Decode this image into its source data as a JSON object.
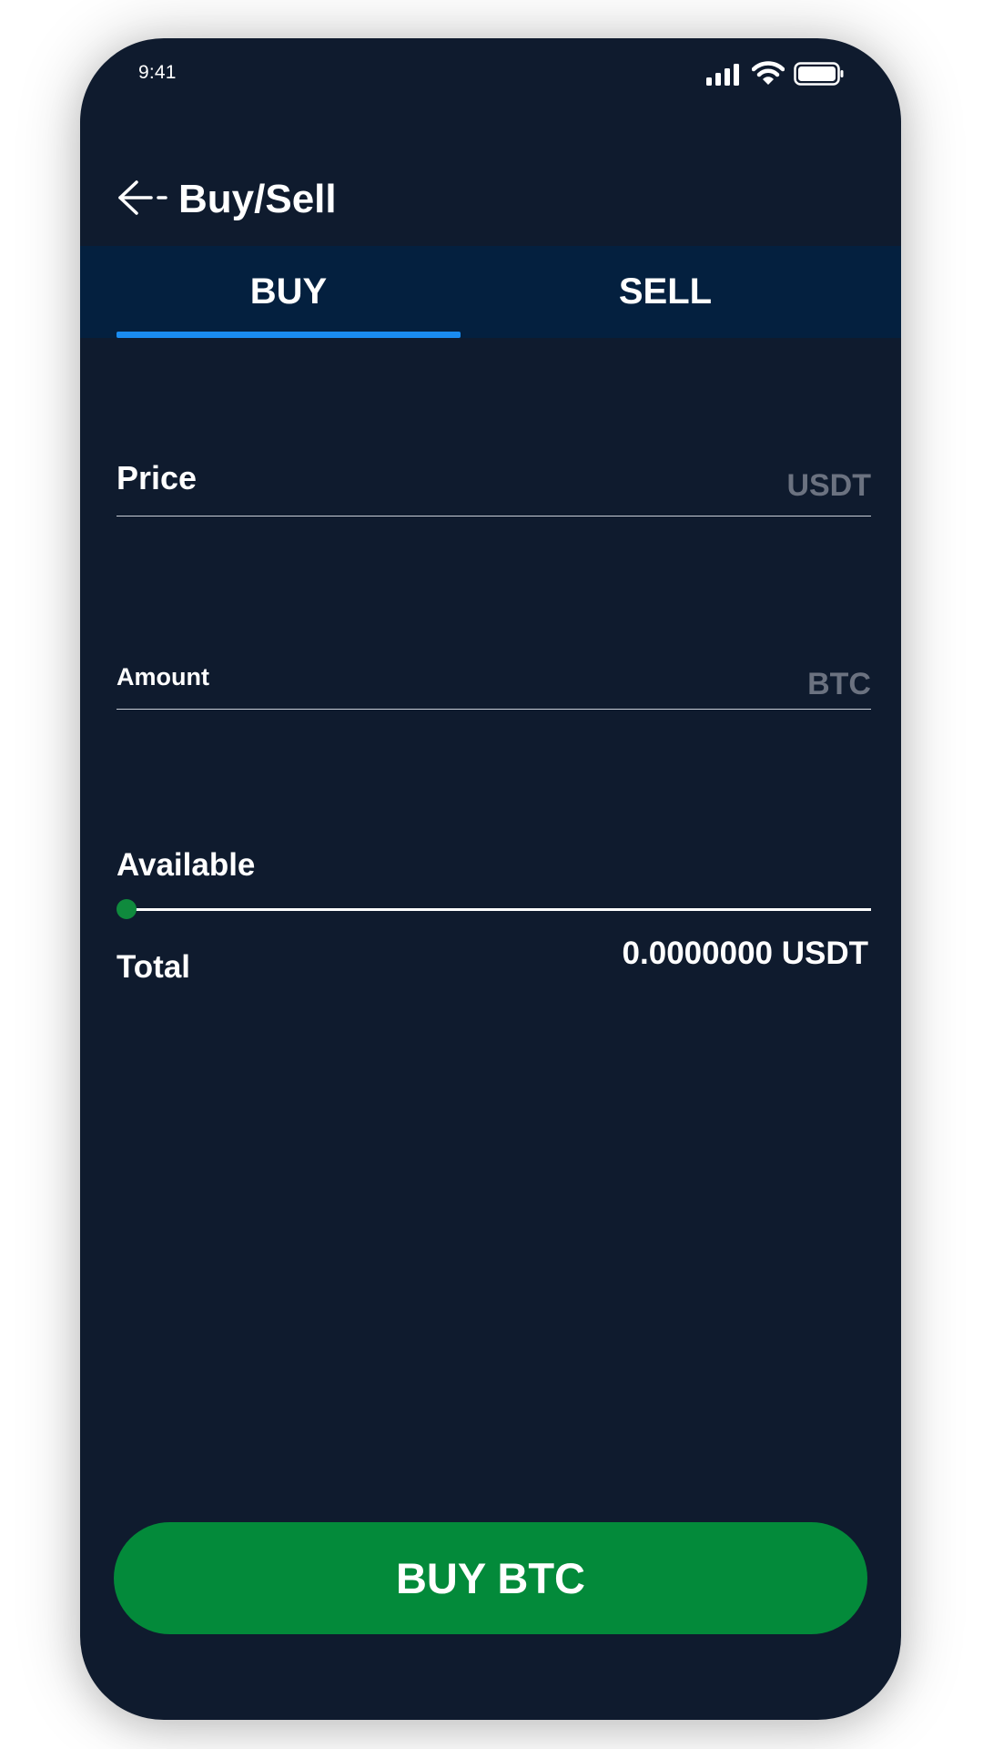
{
  "status_bar": {
    "time": "9:41"
  },
  "header": {
    "back_icon": "arrow-left-icon",
    "title": "Buy/Sell"
  },
  "tabs": [
    {
      "label": "BUY",
      "selected": true
    },
    {
      "label": "SELL",
      "selected": false
    }
  ],
  "form": {
    "price": {
      "label": "Price",
      "unit": "USDT",
      "value": ""
    },
    "amount": {
      "label": "Amount",
      "unit": "BTC",
      "value": ""
    },
    "available": {
      "label": "Available",
      "slider_value": 0
    },
    "total": {
      "label": "Total",
      "value": "0.0000000 USDT"
    }
  },
  "action": {
    "label": "BUY BTC"
  },
  "colors": {
    "background": "#0f1b2e",
    "tab_bar": "#04203f",
    "accent_blue": "#1a8cf0",
    "buy_green": "#038a3a",
    "unit_gray": "#6b7280"
  }
}
